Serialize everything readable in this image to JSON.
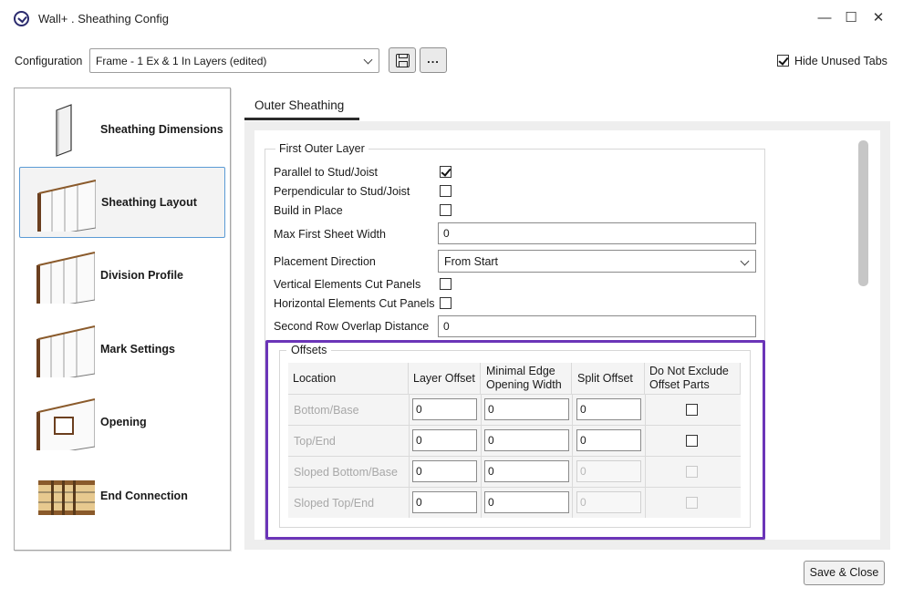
{
  "window": {
    "title": "Wall+ . Sheathing Config",
    "controls": [
      "—",
      "☐",
      "✕"
    ]
  },
  "config": {
    "label": "Configuration",
    "selected": "Frame - 1 Ex & 1 In Layers  (edited)",
    "more_label": "...",
    "hide_unused_tabs_label": "Hide Unused Tabs",
    "hide_unused_tabs_checked": true
  },
  "sidebar": {
    "items": [
      {
        "label": "Sheathing Dimensions",
        "icon": "sheet-panel-icon",
        "selected": false
      },
      {
        "label": "Sheathing Layout",
        "icon": "sheathed-wall-icon",
        "selected": true
      },
      {
        "label": "Division Profile",
        "icon": "sheathed-wall-icon",
        "selected": false
      },
      {
        "label": "Mark Settings",
        "icon": "sheathed-wall-icon",
        "selected": false
      },
      {
        "label": "Opening",
        "icon": "wall-opening-icon",
        "selected": false
      },
      {
        "label": "End Connection",
        "icon": "end-connection-icon",
        "selected": false
      }
    ]
  },
  "tab": {
    "label": "Outer Sheathing"
  },
  "first_outer_layer": {
    "title": "First Outer Layer",
    "parallel_label": "Parallel to Stud/Joist",
    "parallel_checked": true,
    "perpendicular_label": "Perpendicular to Stud/Joist",
    "perpendicular_checked": false,
    "build_in_place_label": "Build in Place",
    "build_in_place_checked": false,
    "max_first_sheet_width_label": "Max First Sheet Width",
    "max_first_sheet_width_value": "0",
    "placement_direction_label": "Placement Direction",
    "placement_direction_value": "From Start",
    "vertical_cut_label": "Vertical Elements Cut Panels",
    "vertical_cut_checked": false,
    "horizontal_cut_label": "Horizontal Elements Cut Panels",
    "horizontal_cut_checked": false,
    "second_row_overlap_label": "Second Row Overlap Distance",
    "second_row_overlap_value": "0"
  },
  "offsets": {
    "title": "Offsets",
    "headers": {
      "location": "Location",
      "layer_offset": "Layer Offset",
      "min_edge_1": "Minimal Edge",
      "min_edge_2": "Opening Width",
      "split_offset": "Split Offset",
      "do_not_exclude_1": "Do Not Exclude",
      "do_not_exclude_2": "Offset Parts"
    },
    "rows": [
      {
        "location": "Bottom/Base",
        "layer_offset": "0",
        "min_edge": "0",
        "split_offset": "0",
        "split_enabled": true
      },
      {
        "location": "Top/End",
        "layer_offset": "0",
        "min_edge": "0",
        "split_offset": "0",
        "split_enabled": true
      },
      {
        "location": "Sloped Bottom/Base",
        "layer_offset": "0",
        "min_edge": "0",
        "split_offset": "0",
        "split_enabled": false
      },
      {
        "location": "Sloped Top/End",
        "layer_offset": "0",
        "min_edge": "0",
        "split_offset": "0",
        "split_enabled": false
      }
    ]
  },
  "footer": {
    "save_close_label": "Save & Close"
  },
  "colors": {
    "highlight_border": "#6b35b8",
    "selected_border": "#5b9bd5"
  }
}
